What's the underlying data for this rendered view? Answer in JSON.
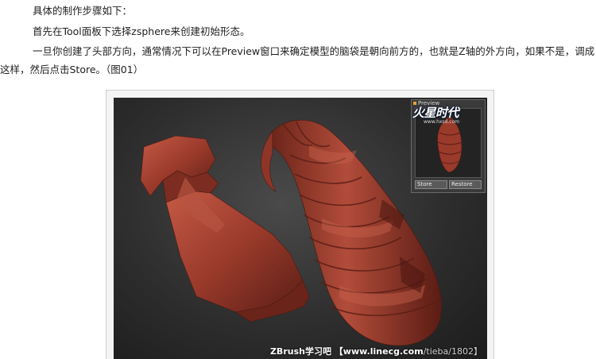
{
  "article": {
    "paragraphs": [
      "具体的制作步骤如下：",
      "首先在Tool面板下选择zsphere来创建初始形态。",
      "一旦你创建了头部方向，通常情况下可以在Preview窗口来确定模型的脑袋是朝向前方的，也就是Z轴的外方向，如果不是，调成",
      "这样，然后点击Store。（图01）"
    ]
  },
  "figure": {
    "preview_title": "Preview",
    "store_label": "Store",
    "restore_label": "Restore",
    "logo_text": "火星时代",
    "logo_sub": "www.hxsd.com",
    "watermark_site": "ZBrush学习吧",
    "watermark_url": "【www.linecg.com",
    "watermark_tieba": "/tieba/1802】",
    "colors": {
      "model": "#a13e2e",
      "model_dark": "#5e1f17",
      "background": "#2e2e2e"
    }
  }
}
